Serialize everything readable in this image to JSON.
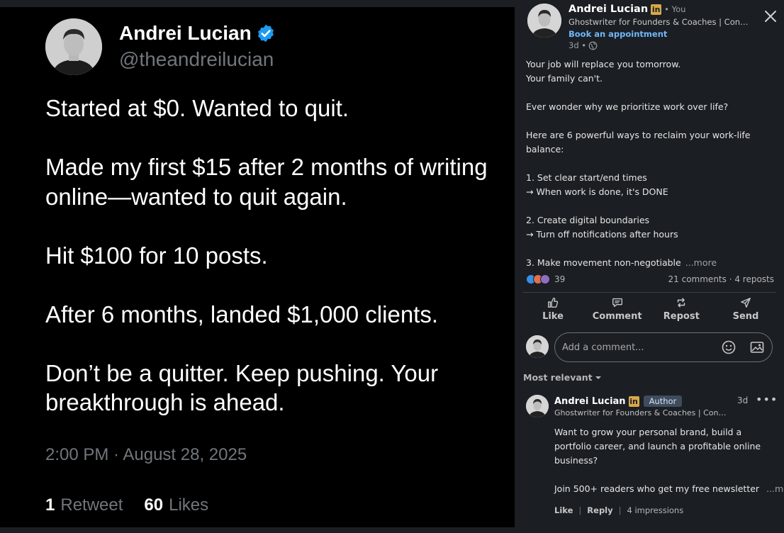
{
  "tweet": {
    "name": "Andrei Lucian",
    "handle": "@theandreilucian",
    "paragraphs": [
      "Started at $0. Wanted to quit.",
      "Made my first $15 after 2 months of writing online—wanted to quit again.",
      "Hit $100 for 10 posts.",
      "After 6 months, landed $1,000 clients.",
      "Don’t be a quitter. Keep pushing. Your breakthrough is ahead."
    ],
    "timestamp": "2:00 PM · August 28, 2025",
    "retweets_count": "1",
    "retweets_label": "Retweet",
    "likes_count": "60",
    "likes_label": "Likes",
    "verified_color": "#1d9bf0"
  },
  "post": {
    "author_name": "Andrei Lucian",
    "linkedin_badge": "in",
    "you_label": "• You",
    "headline": "Ghostwriter for Founders & Coaches | Conten...",
    "book_link": "Book an appointment",
    "age": "3d •",
    "text_lines": [
      "Your job will replace you tomorrow.",
      "Your family can't.",
      "",
      "Ever wonder why we prioritize work over life?",
      "",
      "Here are 6 powerful ways to reclaim your work-life",
      "balance:",
      "",
      "1. Set clear start/end times",
      "→ When work is done, it's DONE",
      "",
      "2. Create digital boundaries",
      "→ Turn off notifications after hours",
      "",
      "3. Make movement non-negotiable"
    ],
    "more_label": "...more",
    "reactions_count": "39",
    "comments_reposts": "21 comments · 4 reposts",
    "actions": {
      "like": "Like",
      "comment": "Comment",
      "repost": "Repost",
      "send": "Send"
    },
    "comment_placeholder": "Add a comment...",
    "sort_label": "Most relevant"
  },
  "comment": {
    "author_name": "Andrei Lucian",
    "linkedin_badge": "in",
    "author_tag": "Author",
    "time": "3d",
    "menu": "•••",
    "headline": "Ghostwriter for Founders & Coaches | Cont...",
    "text_lines": [
      "Want to grow your personal brand, build a",
      "portfolio career, and launch a profitable online",
      "business?",
      ""
    ],
    "last_line": "Join 500+ readers who get my free newsletter",
    "more_label": "...more",
    "like_label": "Like",
    "reply_label": "Reply",
    "impressions": "4 impressions"
  },
  "colors": {
    "tweet_bg": "#000000",
    "panel_bg": "#1b1f23",
    "link_blue": "#71b7fb",
    "linkedin_gold": "#d8a84a"
  }
}
